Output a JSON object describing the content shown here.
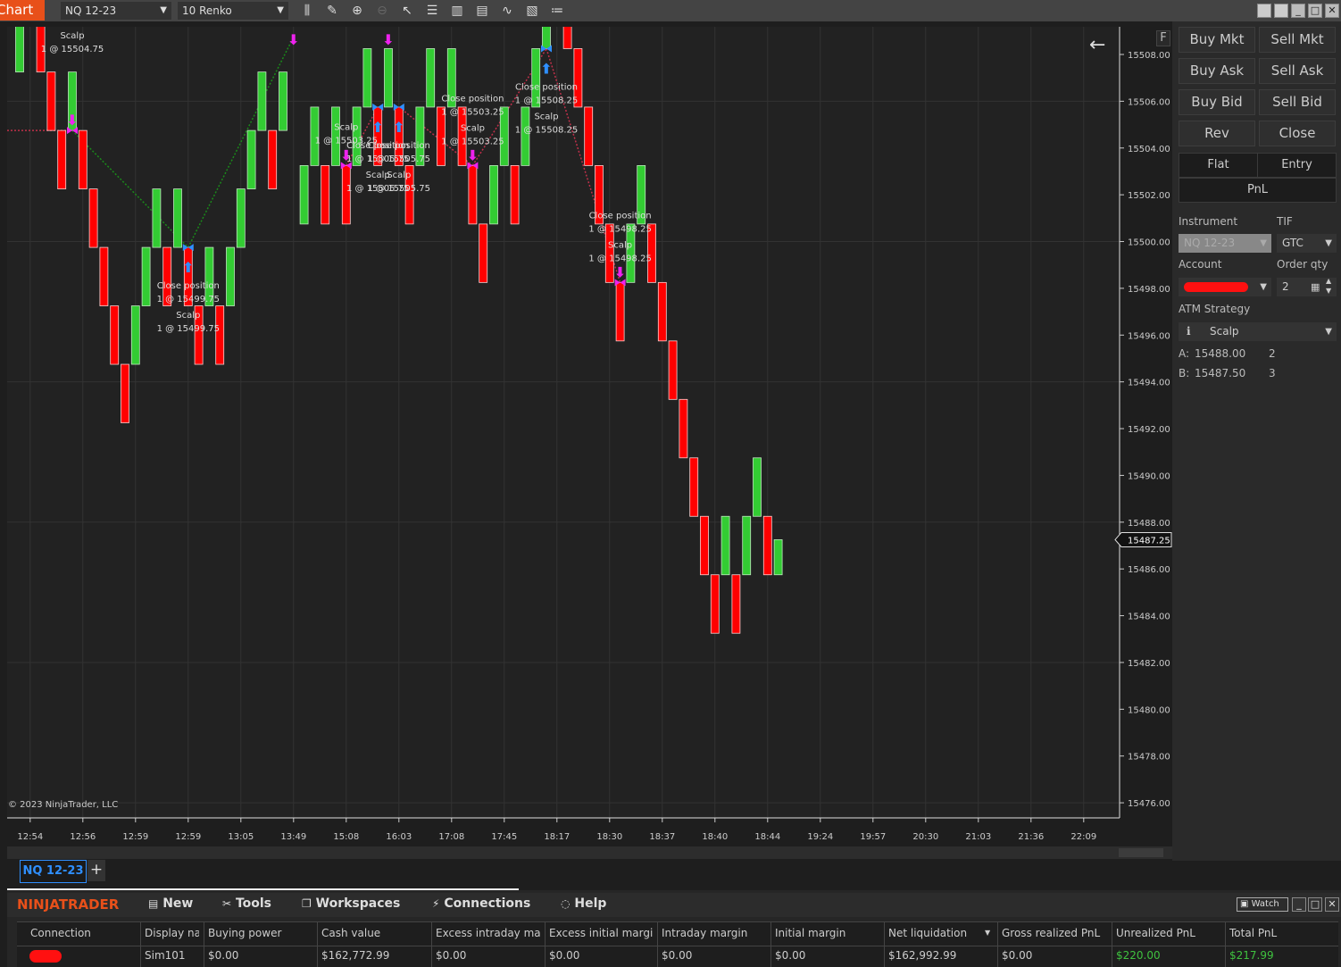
{
  "toolbar": {
    "chart_tab": "Chart",
    "instrument": "NQ 12-23",
    "bar_type": "10 Renko",
    "tools": [
      "bar-style-icon",
      "drawing-tool-icon",
      "zoom-in-icon",
      "zoom-out-icon",
      "pointer-icon",
      "data-box-icon",
      "chart-trader-icon",
      "indicators-icon",
      "strategies-icon",
      "properties-icon",
      "templates-icon"
    ]
  },
  "chart": {
    "copyright": "© 2023 NinjaTrader, LLC",
    "current_price": "15487.25",
    "f_button": "F",
    "colors": {
      "up": "#33cc33",
      "down": "#ff0000",
      "sell_marker": "#ee22ee",
      "buy_marker": "#2f8fff",
      "bg": "#222222"
    },
    "y_ticks": [
      "15508.00",
      "15506.00",
      "15504.00",
      "15502.00",
      "15500.00",
      "15498.00",
      "15496.00",
      "15494.00",
      "15492.00",
      "15490.00",
      "15488.00",
      "15486.00",
      "15484.00",
      "15482.00",
      "15480.00",
      "15478.00",
      "15476.00"
    ],
    "x_ticks": [
      "12:54",
      "12:56",
      "12:59",
      "12:59",
      "13:05",
      "13:49",
      "15:08",
      "16:03",
      "17:08",
      "17:45",
      "18:17",
      "18:30",
      "18:37",
      "18:40",
      "18:44",
      "19:24",
      "19:57",
      "20:30",
      "21:03",
      "21:36",
      "22:09"
    ],
    "annotations": [
      {
        "bar": 5,
        "price": 15504.75,
        "marker": "sell",
        "lines": [
          "Scalp",
          "1 @ 15504.75"
        ],
        "pos": "above"
      },
      {
        "bar": 16,
        "price": 15499.75,
        "marker": "buy",
        "lines": [
          "Close position",
          "1 @ 15499.75",
          "Scalp",
          "1 @ 15499.75"
        ],
        "pos": "below"
      },
      {
        "bar": 31,
        "price": 15503.25,
        "marker": "sell",
        "lines": [
          "Scalp",
          "1 @ 15503.25"
        ],
        "pos": "above"
      },
      {
        "bar": 34,
        "price": 15505.75,
        "marker": "buy",
        "lines": [
          "Close position",
          "1 @ 15505.75",
          "Scalp",
          "1 @ 15505.75"
        ],
        "pos": "below"
      },
      {
        "bar": 36,
        "price": 15505.75,
        "marker": "buy",
        "lines": [
          "Close position",
          "1 @ 15505.75",
          "Scalp",
          "1 @ 15505.75"
        ],
        "pos": "below"
      },
      {
        "bar": 43,
        "price": 15503.25,
        "marker": "sell",
        "lines": [
          "Close position",
          "1 @ 15503.25",
          "Scalp",
          "1 @ 15503.25"
        ],
        "pos": "above"
      },
      {
        "bar": 50,
        "price": 15508.25,
        "marker": "buy",
        "lines": [
          "Close position",
          "1 @ 15508.25",
          "Scalp",
          "1 @ 15508.25"
        ],
        "pos": "below"
      },
      {
        "bar": 57,
        "price": 15498.25,
        "marker": "sell",
        "lines": [
          "Close position",
          "1 @ 15498.25",
          "Scalp",
          "1 @ 15498.25"
        ],
        "pos": "above"
      }
    ]
  },
  "chart_data": {
    "type": "renko",
    "brick_size_ticks": 10,
    "ylim": [
      15475,
      15510
    ],
    "bars": [
      [
        15507.25,
        15509.75
      ],
      null,
      [
        15509.75,
        15507.25
      ],
      [
        15507.25,
        15504.75
      ],
      [
        15504.75,
        15502.25
      ],
      [
        15504.75,
        15507.25
      ],
      [
        15504.75,
        15502.25
      ],
      [
        15502.25,
        15499.75
      ],
      [
        15499.75,
        15497.25
      ],
      [
        15497.25,
        15494.75
      ],
      [
        15494.75,
        15492.25
      ],
      [
        15494.75,
        15497.25
      ],
      [
        15497.25,
        15499.75
      ],
      [
        15499.75,
        15502.25
      ],
      [
        15499.75,
        15497.25
      ],
      [
        15499.75,
        15502.25
      ],
      [
        15499.75,
        15497.25
      ],
      [
        15497.25,
        15494.75
      ],
      [
        15497.25,
        15499.75
      ],
      [
        15497.25,
        15494.75
      ],
      [
        15497.25,
        15499.75
      ],
      [
        15499.75,
        15502.25
      ],
      [
        15502.25,
        15504.75
      ],
      [
        15504.75,
        15507.25
      ],
      [
        15504.75,
        15502.25
      ],
      [
        15504.75,
        15507.25
      ],
      null,
      [
        15500.75,
        15503.25
      ],
      [
        15503.25,
        15505.75
      ],
      [
        15503.25,
        15500.75
      ],
      [
        15503.25,
        15505.75
      ],
      [
        15503.25,
        15500.75
      ],
      [
        15503.25,
        15505.75
      ],
      [
        15505.75,
        15508.25
      ],
      [
        15505.75,
        15503.25
      ],
      [
        15505.75,
        15508.25
      ],
      [
        15505.75,
        15503.25
      ],
      [
        15503.25,
        15500.75
      ],
      [
        15503.25,
        15505.75
      ],
      [
        15505.75,
        15508.25
      ],
      [
        15505.75,
        15503.25
      ],
      [
        15505.75,
        15508.25
      ],
      [
        15505.75,
        15503.25
      ],
      [
        15503.25,
        15500.75
      ],
      [
        15500.75,
        15498.25
      ],
      [
        15500.75,
        15503.25
      ],
      [
        15503.25,
        15505.75
      ],
      [
        15503.25,
        15500.75
      ],
      [
        15503.25,
        15505.75
      ],
      [
        15505.75,
        15508.25
      ],
      [
        15508.25,
        15510.75
      ],
      null,
      [
        15510.75,
        15508.25
      ],
      [
        15508.25,
        15505.75
      ],
      [
        15505.75,
        15503.25
      ],
      [
        15503.25,
        15500.75
      ],
      [
        15500.75,
        15498.25
      ],
      [
        15498.25,
        15495.75
      ],
      [
        15498.25,
        15500.75
      ],
      [
        15500.75,
        15503.25
      ],
      [
        15500.75,
        15498.25
      ],
      [
        15498.25,
        15495.75
      ],
      [
        15495.75,
        15493.25
      ],
      [
        15493.25,
        15490.75
      ],
      [
        15490.75,
        15488.25
      ],
      [
        15488.25,
        15485.75
      ],
      [
        15485.75,
        15483.25
      ],
      [
        15485.75,
        15488.25
      ],
      [
        15485.75,
        15483.25
      ],
      [
        15485.75,
        15488.25
      ],
      [
        15488.25,
        15490.75
      ],
      [
        15488.25,
        15485.75
      ],
      [
        15485.75,
        15487.25
      ]
    ],
    "trades": [
      {
        "from": [
          5,
          15504.75
        ],
        "to": [
          16,
          15499.75
        ],
        "result": "win"
      },
      {
        "from": [
          16,
          15499.75
        ],
        "to": [
          26,
          15508.75
        ],
        "result": "win"
      },
      {
        "from": [
          31,
          15503.25
        ],
        "to": [
          34,
          15505.75
        ],
        "result": "loss"
      },
      {
        "from": [
          36,
          15505.75
        ],
        "to": [
          43,
          15503.25
        ],
        "result": "loss"
      },
      {
        "from": [
          43,
          15503.25
        ],
        "to": [
          50,
          15508.25
        ],
        "result": "loss"
      },
      {
        "from": [
          50,
          15508.25
        ],
        "to": [
          57,
          15498.25
        ],
        "result": "loss"
      }
    ],
    "sell_arrows_top": [
      26,
      35
    ]
  },
  "chart_tabs": {
    "active": "NQ 12-23",
    "add": "+"
  },
  "panel": {
    "buttons": [
      "Buy Mkt",
      "Sell Mkt",
      "Buy Ask",
      "Sell Ask",
      "Buy Bid",
      "Sell Bid",
      "Rev",
      "Close"
    ],
    "position": {
      "flat": "Flat",
      "entry": "Entry",
      "pnl": "PnL"
    },
    "instrument_label": "Instrument",
    "instrument": "NQ 12-23",
    "tif_label": "TIF",
    "tif": "GTC",
    "account_label": "Account",
    "qty_label": "Order qty",
    "qty": "2",
    "atm_label": "ATM Strategy",
    "atm": "Scalp",
    "ask": {
      "label": "A:",
      "price": "15488.00",
      "size": "2"
    },
    "bid": {
      "label": "B:",
      "price": "15487.50",
      "size": "3"
    }
  },
  "control_center": {
    "brand": "NINJATRADER",
    "menu": [
      "New",
      "Tools",
      "Workspaces",
      "Connections",
      "Help"
    ],
    "watch": "Watch",
    "columns": [
      "Connection",
      "Display name",
      "Buying power",
      "Cash value",
      "Excess intraday margin",
      "Excess initial margin",
      "Intraday margin",
      "Initial margin",
      "Net liquidation",
      "Gross realized PnL",
      "Unrealized PnL",
      "Total PnL"
    ],
    "row": [
      "",
      "Sim101",
      "$0.00",
      "$162,772.99",
      "$0.00",
      "$0.00",
      "$0.00",
      "$0.00",
      "$162,992.99",
      "$0.00",
      "$220.00",
      "$217.99"
    ],
    "positive_color": "#3fc23f"
  }
}
